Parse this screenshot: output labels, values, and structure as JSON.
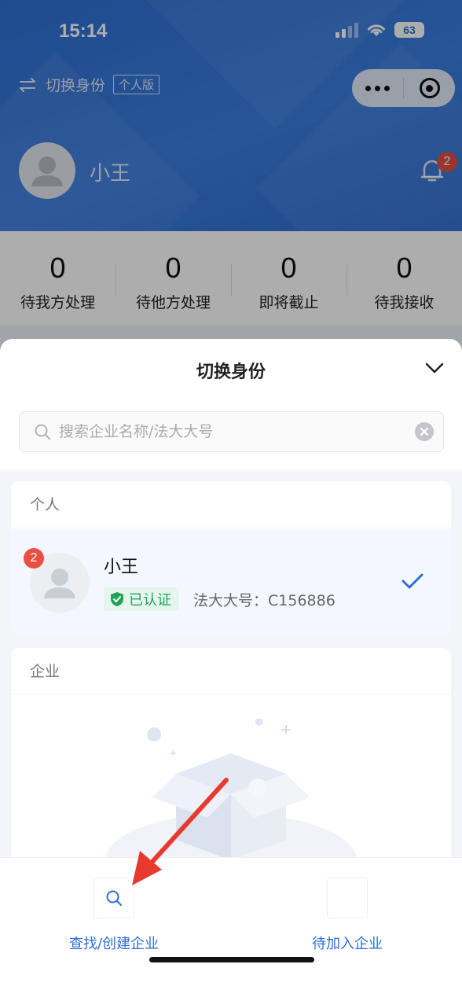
{
  "status_bar": {
    "time": "15:14",
    "battery": "63"
  },
  "header": {
    "switch_label": "切换身份",
    "version_tag": "个人版",
    "user_name": "小王",
    "notification_count": "2"
  },
  "stats": [
    {
      "value": "0",
      "label": "待我方处理"
    },
    {
      "value": "0",
      "label": "待他方处理"
    },
    {
      "value": "0",
      "label": "即将截止"
    },
    {
      "value": "0",
      "label": "待我接收"
    }
  ],
  "sheet": {
    "title": "切换身份",
    "search_placeholder": "搜索企业名称/法大大号",
    "personal_section": "个人",
    "personal": {
      "name": "小王",
      "badge_count": "2",
      "verified_label": "已认证",
      "fadada_id": "法大大号：C156886"
    },
    "company_section": "企业",
    "actions": [
      {
        "label": "查找/创建企业",
        "icon": "search-icon"
      },
      {
        "label": "待加入企业",
        "icon": "pending-icon"
      }
    ]
  },
  "colors": {
    "primary": "#2f6fd3",
    "badge": "#e05043",
    "verified": "#23a25a",
    "arrow": "#e8392f"
  }
}
